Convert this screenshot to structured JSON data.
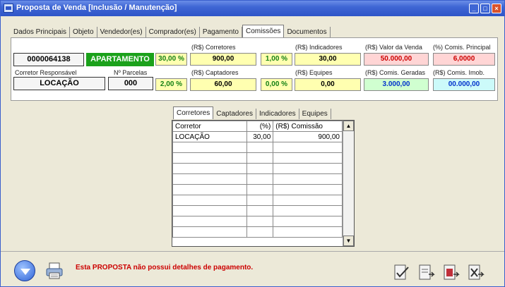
{
  "window": {
    "title": "Proposta de Venda [Inclusão / Manutenção]"
  },
  "tabs": [
    "Dados Principais",
    "Objeto",
    "Vendedor(es)",
    "Comprador(es)",
    "Pagamento",
    "Comissões",
    "Documentos"
  ],
  "active_tab": "Comissões",
  "header": {
    "code": "0000064138",
    "type": "APARTAMENTO",
    "corretor_label": "Corretor Responsável",
    "parcelas_label": "Nº Parcelas",
    "corretor_value": "LOCAÇÃO",
    "parcelas_value": "000"
  },
  "commissions": {
    "corretores_label": "(R$) Corretores",
    "corretores_pct": "30,00 %",
    "corretores_value": "900,00",
    "indicadores_label": "(R$) Indicadores",
    "indicadores_pct": "1,00 %",
    "indicadores_value": "30,00",
    "captadores_label": "(R$) Captadores",
    "captadores_pct": "2,00 %",
    "captadores_value": "60,00",
    "equipes_label": "(R$) Equipes",
    "equipes_pct": "0,00 %",
    "equipes_value": "0,00",
    "valor_venda_label": "(R$) Valor da Venda",
    "valor_venda_value": "50.000,00",
    "comis_principal_label": "(%) Comis. Principal",
    "comis_principal_value": "6,0000",
    "comis_geradas_label": "(R$) Comis. Geradas",
    "comis_geradas_value": "3.000,00",
    "comis_imob_label": "(R$) Comis. Imob.",
    "comis_imob_value": "00.000,00"
  },
  "subtabs": [
    "Corretores",
    "Captadores",
    "Indicadores",
    "Equipes"
  ],
  "grid": {
    "headers": [
      "Corretor",
      "(%)",
      "(R$) Comissão"
    ],
    "rows": [
      [
        "LOCAÇÃO",
        "30,00",
        "900,00"
      ]
    ]
  },
  "status": {
    "message": "Esta PROPOSTA não possui detalhes de pagamento."
  },
  "colors": {
    "title_bar": "#2e55c8",
    "badge_green": "#1ba11b",
    "alert_red": "#cc0000"
  }
}
